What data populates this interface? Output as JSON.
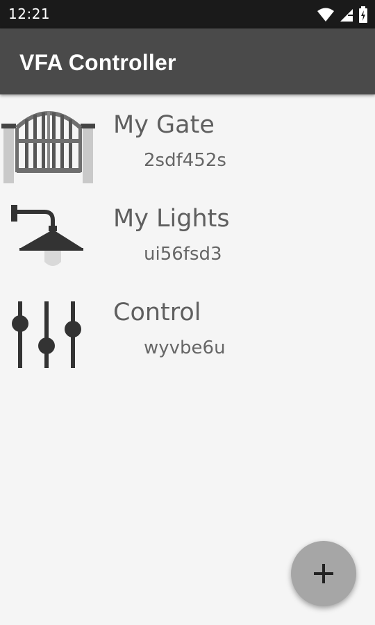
{
  "status_bar": {
    "time": "12:21",
    "icons": [
      "wifi-icon",
      "cell-signal-icon",
      "battery-charging-icon"
    ]
  },
  "app_bar": {
    "title": "VFA Controller"
  },
  "devices": [
    {
      "name": "My Gate",
      "code": "2sdf452s",
      "icon": "gate-icon"
    },
    {
      "name": "My Lights",
      "code": "ui56fsd3",
      "icon": "wall-lamp-icon"
    },
    {
      "name": "Control",
      "code": "wyvbe6u",
      "icon": "sliders-icon"
    }
  ],
  "fab": {
    "icon": "plus-icon"
  },
  "colors": {
    "status_bar": "#1a1a1a",
    "app_bar": "#4a4a4a",
    "background": "#f5f5f5",
    "fab": "#a6a6a6"
  }
}
